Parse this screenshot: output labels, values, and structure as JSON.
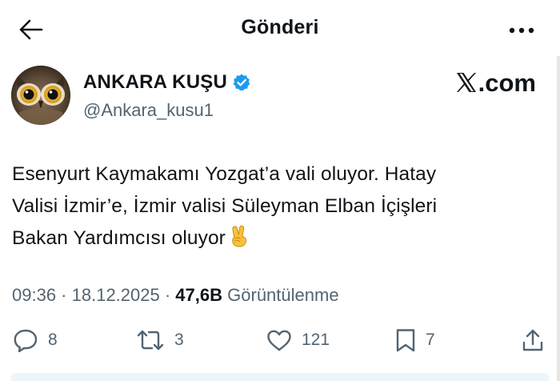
{
  "header": {
    "title": "Gönderi",
    "back_icon": "arrow-left-icon",
    "more_icon": "more-horizontal-icon"
  },
  "author": {
    "name": "ANKARA KUŞU",
    "handle": "@Ankara_kusu1",
    "verified": true,
    "verified_color": "#1d9bf0",
    "avatar": "owl-avatar"
  },
  "brand": {
    "label": ".com",
    "icon": "x-logo-icon"
  },
  "tweet": {
    "lines": [
      "Esenyurt Kaymakamı Yozgat’a vali oluyor. Hatay",
      "Valisi İzmir’e, İzmir valisi Süleyman Elban İçişleri",
      "Bakan Yardımcısı oluyor"
    ],
    "emoji": "victory-hand-emoji"
  },
  "meta": {
    "time": "09:36",
    "separator": " · ",
    "date": "18.12.2025",
    "views_count": "47,6B",
    "views_label": "Görüntülenme"
  },
  "actions": {
    "replies": "8",
    "retweets": "3",
    "likes": "121",
    "bookmarks": "7"
  },
  "colors": {
    "text": "#0f1419",
    "secondary": "#536471",
    "accent": "#1d9bf0"
  }
}
